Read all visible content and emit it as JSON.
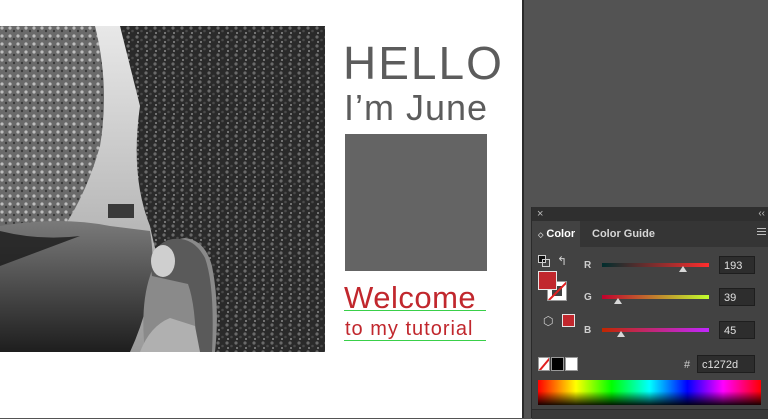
{
  "artboard": {
    "hello": "HELLO",
    "june": "I’m June",
    "welcome": "Welcome",
    "tutorial": "to my tutorial"
  },
  "color_panel": {
    "tabs": [
      {
        "label": "Color",
        "active": true
      },
      {
        "label": "Color Guide",
        "active": false
      }
    ],
    "channels": [
      {
        "label": "R",
        "value": "193",
        "fraction": 0.757
      },
      {
        "label": "G",
        "value": "39",
        "fraction": 0.153
      },
      {
        "label": "B",
        "value": "45",
        "fraction": 0.176
      }
    ],
    "hash": "#",
    "hex": "c1272d",
    "fill_color": "#c1272d"
  },
  "icons": {
    "close": "×",
    "collapse": "‹‹",
    "tab_arrows": "◇",
    "swap": "↰",
    "cube": "⬡"
  }
}
